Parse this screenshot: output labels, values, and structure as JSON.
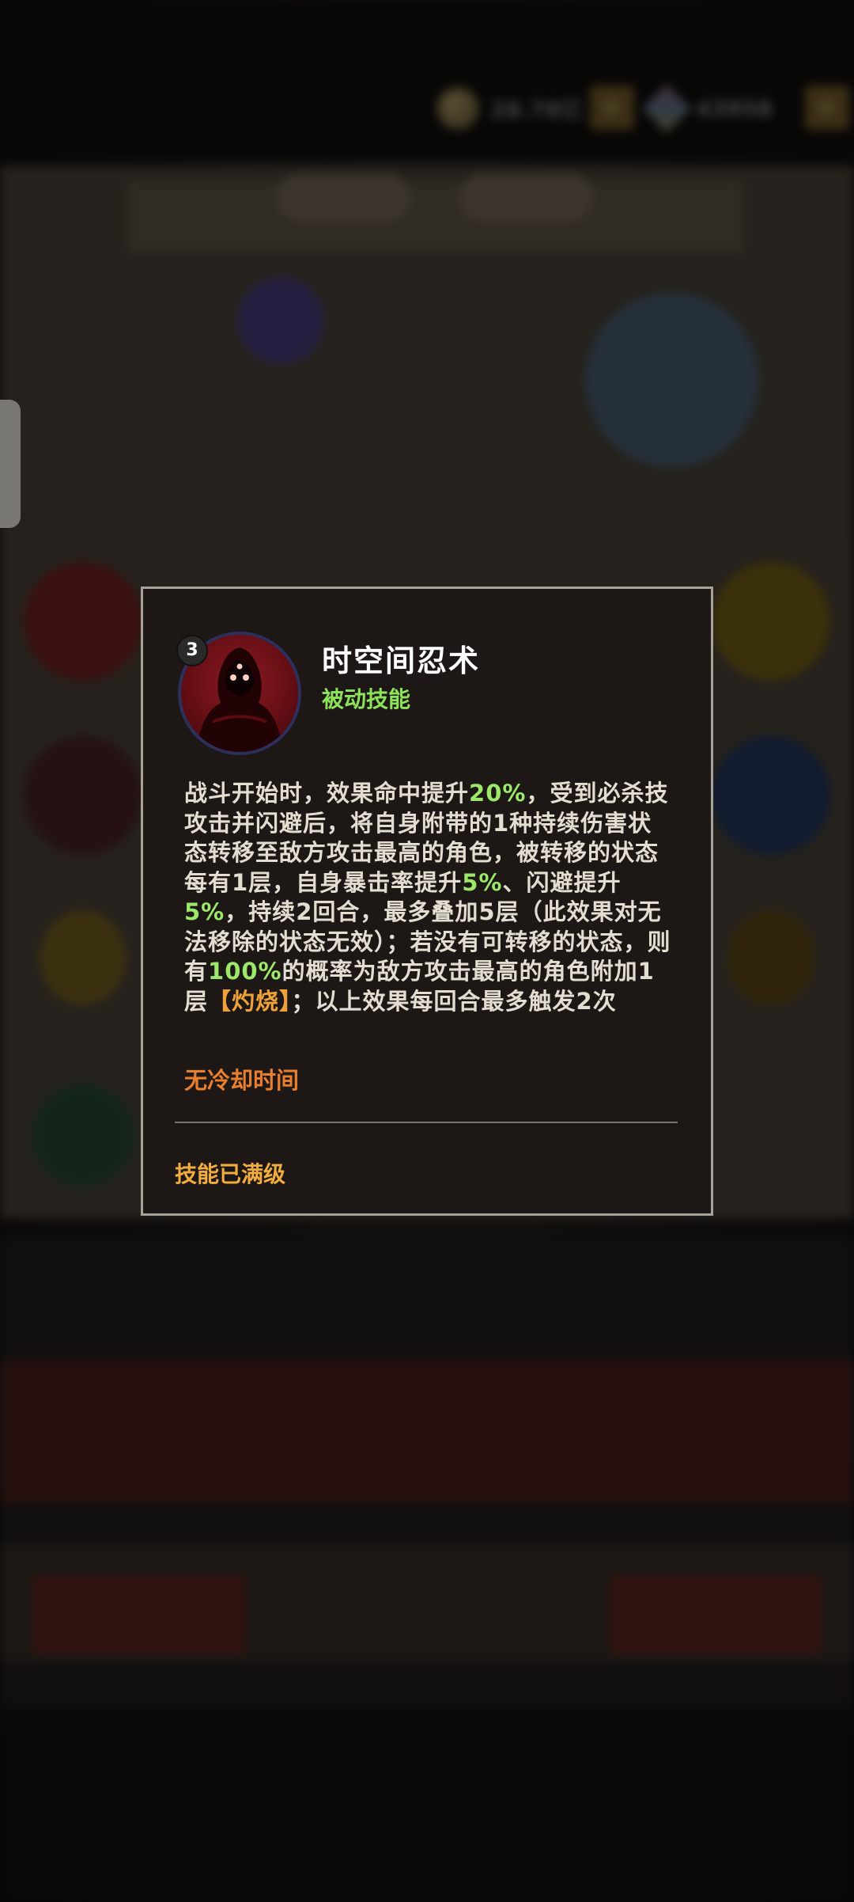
{
  "resources": {
    "gold_value": "28.78亿",
    "gem_value": "43958"
  },
  "skill": {
    "level": "3",
    "name": "时空间忍术",
    "type": "被动技能",
    "description_parts": [
      {
        "text": "战斗开始时，效果命中提升",
        "style": "normal"
      },
      {
        "text": "20%",
        "style": "green"
      },
      {
        "text": "，受到必杀技攻击并闪避后，将自身附带的1种持续伤害状态转移至敌方攻击最高的角色，被转移的状态每有1层，自身暴击率提升",
        "style": "normal"
      },
      {
        "text": "5%",
        "style": "green"
      },
      {
        "text": "、闪避提升",
        "style": "normal"
      },
      {
        "text": "5%",
        "style": "green"
      },
      {
        "text": "，持续2回合，最多叠加5层（此效果对无法移除的状态无效）；若没有可转移的状态，则有",
        "style": "normal"
      },
      {
        "text": "100%",
        "style": "green"
      },
      {
        "text": "的概率为敌方攻击最高的角色附加1层",
        "style": "normal"
      },
      {
        "text": "【灼烧】",
        "style": "orange"
      },
      {
        "text": "；以上效果每回合最多触发2次",
        "style": "normal"
      }
    ],
    "cooldown": "无冷却时间",
    "status": "技能已满级"
  },
  "colors": {
    "highlight_green": "#9ce86a",
    "highlight_orange": "#f0a23a",
    "skill_type_green": "#8de35a",
    "cooldown_orange": "#e77f2e",
    "maxed_gold": "#f1ad40"
  },
  "icons": {
    "skill_icon": "hooded-red-figure-icon",
    "gold": "coin-icon",
    "gem": "gem-icon"
  }
}
